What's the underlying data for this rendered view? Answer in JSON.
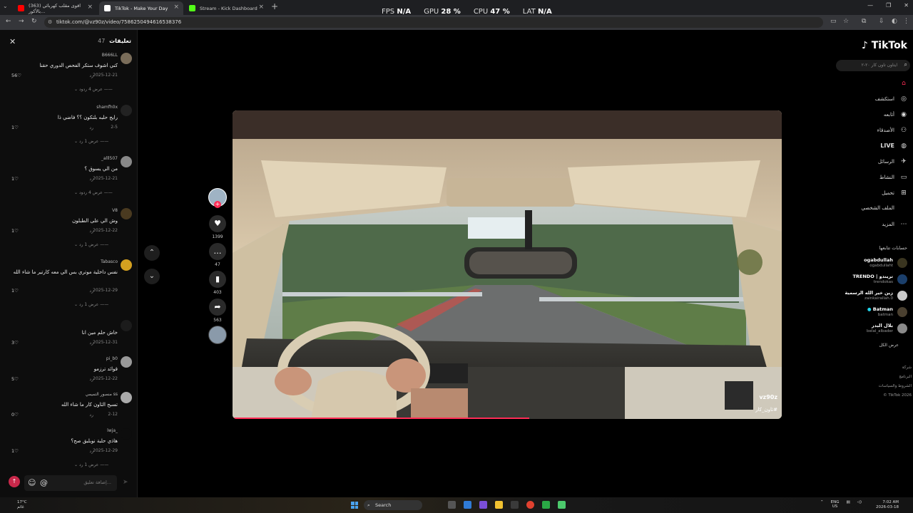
{
  "browser": {
    "tabs": [
      {
        "label": "(363) اقوى مقلب كهربائي بالأكور...",
        "favicon_color": "#ff0000"
      },
      {
        "label": "TikTok - Make Your Day",
        "favicon_color": "#ffffff"
      },
      {
        "label": "Stream - Kick Dashboard",
        "favicon_color": "#53fc18"
      }
    ],
    "url": "tiktok.com/@vz90z/video/7586250494616538376",
    "overlay_stats": [
      {
        "label": "FPS",
        "value": "N/A"
      },
      {
        "label": "GPU",
        "value": "28 %"
      },
      {
        "label": "CPU",
        "value": "47 %"
      },
      {
        "label": "LAT",
        "value": "N/A"
      }
    ]
  },
  "comments": {
    "title": "تعليقات",
    "count": "47",
    "input_placeholder": "إضافة تعليق...",
    "items": [
      {
        "user": "B666LL",
        "text": "كني اشوف ستكر الفحص الدوري حقنا",
        "date": "2025-12-21",
        "reply": "رد",
        "likes": "56",
        "more": "عرض 4 ردود"
      },
      {
        "user": "shamfh0x",
        "text": "رايح حلبه بلتكون ؟؟ فاضي ذا",
        "date": "2-5",
        "reply": "رد",
        "likes": "1",
        "more": "عرض 1 رد"
      },
      {
        "user": "_alll507",
        "text": "من الي يسوق ؟",
        "date": "2025-12-21",
        "reply": "رد",
        "likes": "1",
        "more": "عرض 4 ردود"
      },
      {
        "user": "V8",
        "text": "وش الي على الطبلون",
        "date": "2025-12-22",
        "reply": "رد",
        "likes": "1",
        "more": "عرض 1 رد"
      },
      {
        "user": "Tabasco",
        "text": "نفس داخلية موتري بس الي معه كارتير ما شاء الله",
        "date": "2025-12-29",
        "reply": "رد",
        "likes": "1",
        "more": "عرض 1 رد"
      },
      {
        "user": "",
        "text": "خاش حلم مين انا",
        "date": "2025-12-31",
        "reply": "رد",
        "likes": "3",
        "more": ""
      },
      {
        "user": "pi_b0",
        "text": "قوائد ترزمو",
        "date": "2025-12-22",
        "reply": "رد",
        "likes": "5",
        "more": ""
      },
      {
        "user": "منصور التميمي ss",
        "text": "تسبح الثاون كار ما شاء الله",
        "date": "2-12",
        "reply": "رد",
        "likes": "0",
        "more": ""
      },
      {
        "user": "lwja_",
        "text": "هاذي حلبة نوبلبق صح؟",
        "date": "2025-12-29",
        "reply": "رد",
        "likes": "1",
        "more": "عرض 1 رد"
      }
    ]
  },
  "video": {
    "author": "vz90z",
    "hashtag": "#ثاون_كار",
    "progress_fraction": 0.54
  },
  "actions": {
    "likes": "1399",
    "comments": "47",
    "saves": "403",
    "shares": "563"
  },
  "sidebar": {
    "logo": "TikTok",
    "search_placeholder": "ايتاون تاون كار ٢٠-٢",
    "nav": [
      {
        "label": "",
        "icon": "home-icon",
        "glyph": "⌂"
      },
      {
        "label": "استكشف",
        "icon": "compass-icon",
        "glyph": "◎"
      },
      {
        "label": "أتابعه",
        "icon": "following-icon",
        "glyph": "◉"
      },
      {
        "label": "الأصدقاء",
        "icon": "friends-icon",
        "glyph": "👥"
      },
      {
        "label": "LIVE",
        "icon": "live-icon",
        "glyph": "◍"
      },
      {
        "label": "الرسائل",
        "icon": "messages-icon",
        "glyph": "✈"
      },
      {
        "label": "النشاط",
        "icon": "activity-icon",
        "glyph": "▭"
      },
      {
        "label": "تحميل",
        "icon": "upload-icon",
        "glyph": "⊞"
      },
      {
        "label": "الملف الشخصي",
        "icon": "profile-icon",
        "glyph": ""
      },
      {
        "label": "المزيد",
        "icon": "more-icon",
        "glyph": "⋯"
      }
    ],
    "following_title": "حسابات تتابعها",
    "accounts": [
      {
        "name": "ogabdullah",
        "handle": "ogabdullaht"
      },
      {
        "name": "TRENDO | تريندو",
        "handle": "trendokas"
      },
      {
        "name": "زين خير الله الرسمية",
        "handle": "zainkairallah.0"
      },
      {
        "name": "Batman",
        "handle": "batman"
      },
      {
        "name": "بلال البدر",
        "handle": "belal_albader"
      }
    ],
    "show_all": "عرض الكل",
    "footer": [
      "شركة",
      "البرنامج",
      "الشروط والسياسات",
      "TikTok 2026 ©"
    ]
  },
  "taskbar": {
    "weather_temp": "17°C",
    "weather_desc": "غائم",
    "search": "Search",
    "lang": "ENG",
    "region": "US",
    "time": "7:02 AM",
    "date": "2026-03-18"
  }
}
